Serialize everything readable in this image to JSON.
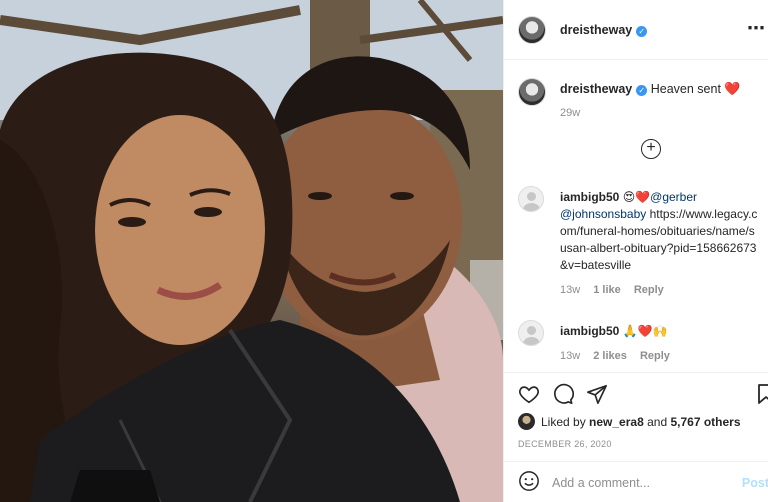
{
  "post": {
    "username": "dreistheway",
    "verified_mark": "✓",
    "more_icon": "⋯",
    "caption": {
      "username": "dreistheway",
      "text": "Heaven sent",
      "emoji": "❤️",
      "age": "29w"
    },
    "load_more_icon": "plus-circle-icon"
  },
  "comments": [
    {
      "username": "iambigb50",
      "emoji": "😍❤️",
      "tag1": "@gerber",
      "tag2": "@johnsonsbaby",
      "text": "https://www.legacy.com/funeral-homes/obituaries/name/susan-albert-obituary?pid=158662673&v=batesville",
      "age": "13w",
      "likes": "1 like",
      "reply": "Reply"
    },
    {
      "username": "iambigb50",
      "emoji": "🙏❤️🙌",
      "age": "13w",
      "likes": "2 likes",
      "reply": "Reply"
    }
  ],
  "likes": {
    "prefix": "Liked by",
    "user": "new_era8",
    "joiner": "and",
    "others": "5,767 others"
  },
  "date": "DECEMBER 26, 2020",
  "add_comment": {
    "placeholder": "Add a comment...",
    "post_label": "Post"
  },
  "colors": {
    "verified": "#3897f0",
    "tag": "#00376b",
    "muted": "#8e8e8e",
    "post_disabled": "#b2dffc"
  }
}
